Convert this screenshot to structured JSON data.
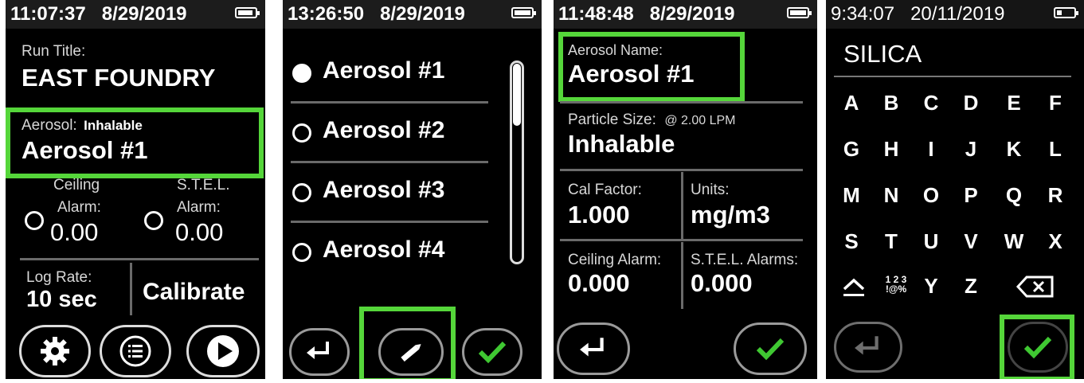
{
  "colors": {
    "highlight": "#55d63a",
    "check": "#3fc832",
    "background": "#000000"
  },
  "screen1": {
    "time": "11:07:37",
    "date": "8/29/2019",
    "run_title_label": "Run Title:",
    "run_title": "EAST FOUNDRY",
    "aerosol_label": "Aerosol:",
    "aerosol_type": "Inhalable",
    "aerosol_name": "Aerosol #1",
    "ceiling_label": "Ceiling",
    "ceiling_alarm_label": "Alarm:",
    "ceiling_value": "0.00",
    "stel_label": "S.T.E.L.",
    "stel_alarm_label": "Alarm:",
    "stel_value": "0.00",
    "lograte_label": "Log Rate:",
    "lograte_value": "10 sec",
    "calibrate_label": "Calibrate",
    "icons": [
      "gear-icon",
      "list-icon",
      "play-icon"
    ]
  },
  "screen2": {
    "time": "13:26:50",
    "date": "8/29/2019",
    "items": [
      "Aerosol #1",
      "Aerosol #2",
      "Aerosol #3",
      "Aerosol #4"
    ],
    "selected": 0,
    "icons": [
      "back-icon",
      "pencil-icon",
      "check-icon"
    ]
  },
  "screen3": {
    "time": "11:48:48",
    "date": "8/29/2019",
    "aerosol_name_label": "Aerosol Name:",
    "aerosol_name": "Aerosol #1",
    "particle_label": "Particle Size:",
    "particle_flow": "@ 2.00 LPM",
    "particle_value": "Inhalable",
    "cal_label": "Cal Factor:",
    "cal_value": "1.000",
    "units_label": "Units:",
    "units_value": "mg/m3",
    "ceiling_label": "Ceiling Alarm:",
    "ceiling_value": "0.000",
    "stel_label": "S.T.E.L. Alarms:",
    "stel_value": "0.000",
    "icons": [
      "back-icon",
      "check-icon"
    ]
  },
  "screen4": {
    "time": "9:34:07",
    "date": "20/11/2019",
    "input_value": "SILICA",
    "rows": [
      [
        "A",
        "B",
        "C",
        "D",
        "E",
        "F"
      ],
      [
        "G",
        "H",
        "I",
        "J",
        "K",
        "L"
      ],
      [
        "M",
        "N",
        "O",
        "P",
        "Q",
        "R"
      ],
      [
        "S",
        "T",
        "U",
        "V",
        "W",
        "X"
      ]
    ],
    "symbols_key_top": "1 2 3",
    "symbols_key_bottom": "!@%",
    "key_y": "Y",
    "key_z": "Z",
    "icons": [
      "shift-icon",
      "backspace-icon",
      "back-icon",
      "check-icon"
    ]
  }
}
